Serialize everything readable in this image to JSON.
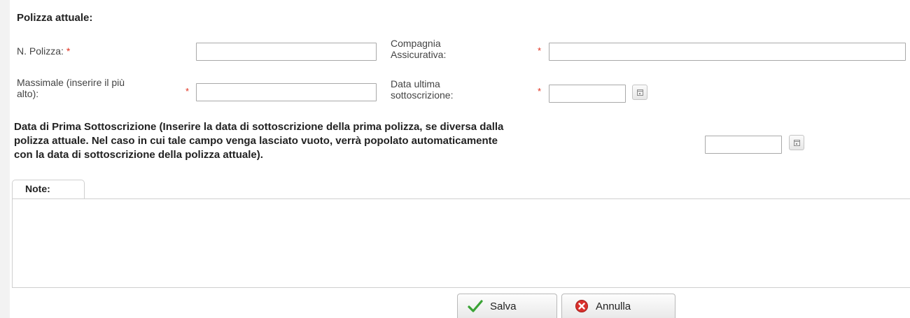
{
  "section": {
    "title": "Polizza attuale:"
  },
  "fields": {
    "n_polizza": {
      "label": "N. Polizza:",
      "required": "*",
      "value": ""
    },
    "compagnia": {
      "label_line1": "Compagnia",
      "label_line2": "Assicurativa:",
      "required": "*",
      "value": ""
    },
    "massimale": {
      "label_line1": "Massimale (inserire il più",
      "label_line2": "alto):",
      "required": "*",
      "value": ""
    },
    "data_ultima": {
      "label_line1": "Data ultima",
      "label_line2": "sottoscrizione:",
      "required": "*",
      "value": ""
    },
    "data_prima": {
      "label_line1": "Data di Prima Sottoscrizione (Inserire la data di sottoscrizione della prima polizza, se diversa dalla",
      "label_line2": "polizza attuale. Nel caso in cui tale campo venga lasciato vuoto, verrà popolato automaticamente",
      "label_line3": "con la data di sottoscrizione della polizza attuale).",
      "value": ""
    }
  },
  "note": {
    "tab_label": "Note:",
    "value": ""
  },
  "buttons": {
    "save": {
      "label": "Salva",
      "icon": "checkmark-icon",
      "color": "#3aa335"
    },
    "cancel": {
      "label": "Annulla",
      "icon": "cancel-icon",
      "color": "#d9302c"
    }
  }
}
